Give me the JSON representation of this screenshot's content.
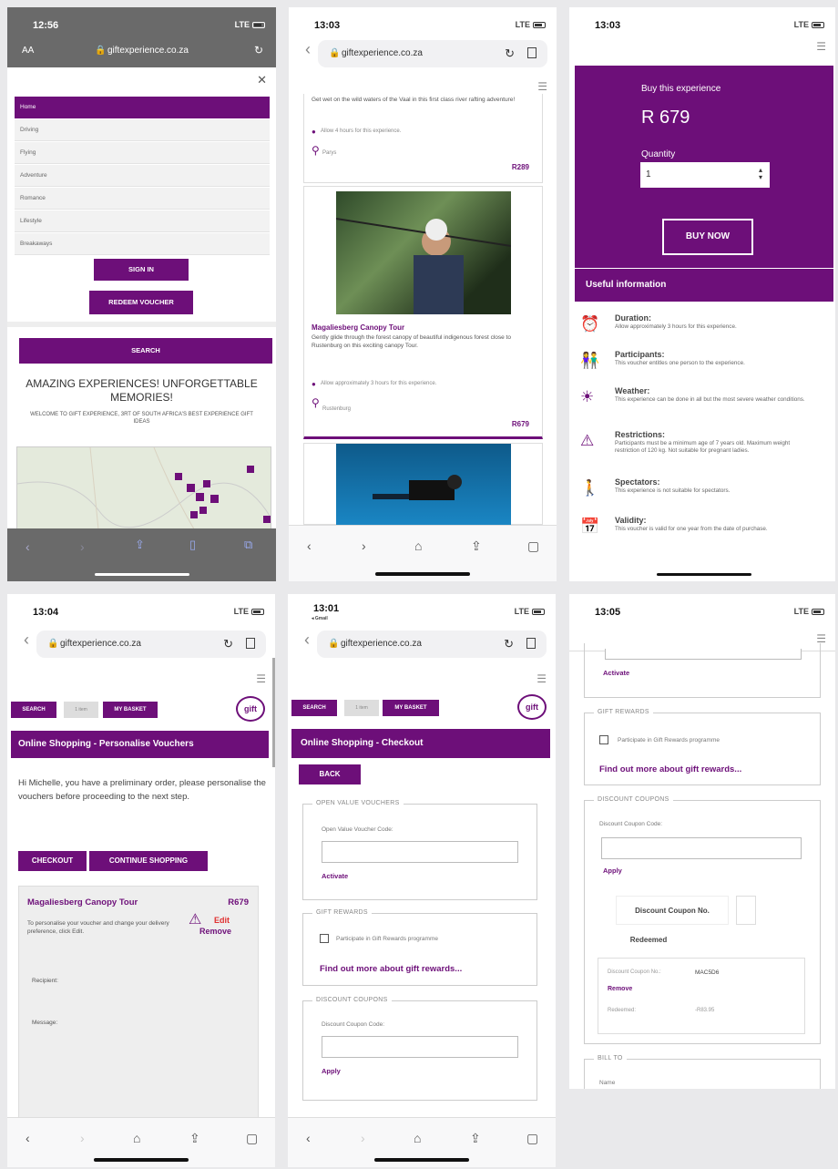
{
  "colors": {
    "brand": "#6d0f79",
    "price": "#6d0f79",
    "warn": "#e03030"
  },
  "p1": {
    "time": "12:56",
    "signal": "LTE",
    "aa": "AA",
    "url": "giftexperience.co.za",
    "close": "✕",
    "menu": [
      "Home",
      "Driving",
      "Flying",
      "Adventure",
      "Romance",
      "Lifestyle",
      "Breakaways"
    ],
    "signin": "SIGN IN",
    "redeem": "REDEEM VOUCHER",
    "search": "SEARCH",
    "headline": "AMAZING EXPERIENCES! UNFORGETTABLE MEMORIES!",
    "sub": "WELCOME TO GIFT EXPERIENCE, 3RT OF SOUTH AFRICA'S BEST EXPERIENCE GIFT IDEAS"
  },
  "p2": {
    "time": "13:03",
    "signal": "LTE",
    "url": "giftexperience.co.za",
    "top_desc": "Get wet on the wild waters of the Vaal in this first class river rafting adventure!",
    "top_duration": "Allow 4 hours for this experience.",
    "top_loc": "Parys",
    "top_price": "R289",
    "card_title": "Magaliesberg Canopy Tour",
    "card_desc": "Gently glide through the forest canopy of beautiful indigenous forest close to Rustenburg on this exciting canopy Tour.",
    "card_duration": "Allow approximately 3 hours for this experience.",
    "card_loc": "Rustenburg",
    "card_price": "R679"
  },
  "p3": {
    "time": "13:03",
    "signal": "LTE",
    "buy_label": "Buy this experience",
    "price": "R 679",
    "qty_label": "Quantity",
    "qty": "1",
    "buy_now": "BUY NOW",
    "useful": "Useful information",
    "info": [
      {
        "icon": "clock-icon",
        "glyph": "⏰",
        "title": "Duration:",
        "text": "Allow approximately 3 hours for this experience."
      },
      {
        "icon": "people-icon",
        "glyph": "👫",
        "title": "Participants:",
        "text": "This voucher entitles one person to the experience."
      },
      {
        "icon": "sun-icon",
        "glyph": "☀",
        "title": "Weather:",
        "text": "This experience can be done in all but the most severe weather conditions."
      },
      {
        "icon": "warning-icon",
        "glyph": "⚠",
        "title": "Restrictions:",
        "text": "Participants must be a minimum age of 7 years old. Maximum weight restriction of 120 kg. Not suitable for pregnant ladies."
      },
      {
        "icon": "spectator-icon",
        "glyph": "🚶",
        "title": "Spectators:",
        "text": "This experience is not suitable for spectators."
      },
      {
        "icon": "calendar-icon",
        "glyph": "📅",
        "title": "Validity:",
        "text": "This voucher is valid for one year from the date of purchase."
      }
    ]
  },
  "p4": {
    "time": "13:04",
    "signal": "LTE",
    "url": "giftexperience.co.za",
    "search": "SEARCH",
    "input": "1 item",
    "basket": "MY BASKET",
    "logo": "gift",
    "heading": "Online Shopping - Personalise Vouchers",
    "intro": "Hi Michelle, you have a preliminary order, please personalise the vouchers before proceeding to the next step.",
    "checkout": "CHECKOUT",
    "continue": "CONTINUE SHOPPING",
    "item_title": "Magaliesberg Canopy Tour",
    "item_price": "R679",
    "item_desc": "To personalise your voucher and change your delivery preference, click Edit.",
    "edit": "Edit",
    "remove": "Remove",
    "recipient": "Recipient:",
    "message": "Message:"
  },
  "p5": {
    "time": "13:01",
    "gmail": "◂ Gmail",
    "signal": "LTE",
    "url": "giftexperience.co.za",
    "search": "SEARCH",
    "input": "1 item",
    "basket": "MY BASKET",
    "logo": "gift",
    "heading": "Online Shopping - Checkout",
    "back": "BACK",
    "ovv": "OPEN VALUE VOUCHERS",
    "ovv_label": "Open Value Voucher Code:",
    "activate": "Activate",
    "gr": "GIFT REWARDS",
    "gr_label": "Participate in Gift Rewards programme",
    "gr_link": "Find out more about gift rewards...",
    "dc": "DISCOUNT COUPONS",
    "dc_label": "Discount Coupon Code:",
    "apply": "Apply"
  },
  "p6": {
    "time": "13:05",
    "signal": "LTE",
    "activate": "Activate",
    "gr": "GIFT REWARDS",
    "gr_label": "Participate in Gift Rewards programme",
    "gr_link": "Find out more about gift rewards...",
    "dc": "DISCOUNT COUPONS",
    "dc_label": "Discount Coupon Code:",
    "apply": "Apply",
    "coupon_no": "Discount Coupon No.",
    "redeemed": "Redeemed",
    "row_label": "Discount Coupon No.:",
    "row_code": "MAC5D6",
    "remove": "Remove",
    "row_red_label": "Redeemed:",
    "row_red_val": "-R83.95",
    "bill": "BILL TO",
    "name": "Name"
  }
}
